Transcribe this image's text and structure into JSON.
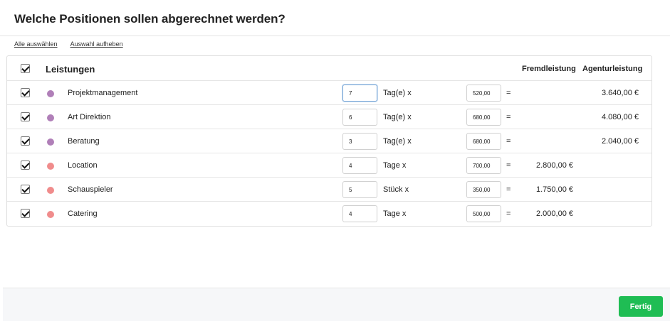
{
  "dialog": {
    "title": "Welche Positionen sollen abgerechnet werden?"
  },
  "links": {
    "select_all": "Alle auswählen",
    "deselect": "Auswahl aufheben"
  },
  "table": {
    "header": {
      "label": "Leistungen",
      "col_fremd": "Fremdleistung",
      "col_agentur": "Agenturleistung"
    },
    "rows": [
      {
        "name": "Projektmanagement",
        "qty": "7",
        "unit": "Tag(e) x",
        "price": "520,00",
        "eq": "=",
        "fremd": "",
        "agentur": "3.640,00 €",
        "color": "#b07fb8"
      },
      {
        "name": "Art Direktion",
        "qty": "6",
        "unit": "Tag(e) x",
        "price": "680,00",
        "eq": "=",
        "fremd": "",
        "agentur": "4.080,00 €",
        "color": "#b07fb8"
      },
      {
        "name": "Beratung",
        "qty": "3",
        "unit": "Tag(e) x",
        "price": "680,00",
        "eq": "=",
        "fremd": "",
        "agentur": "2.040,00 €",
        "color": "#b07fb8"
      },
      {
        "name": "Location",
        "qty": "4",
        "unit": "Tage x",
        "price": "700,00",
        "eq": "=",
        "fremd": "2.800,00 €",
        "agentur": "",
        "color": "#f08c8c"
      },
      {
        "name": "Schauspieler",
        "qty": "5",
        "unit": "Stück x",
        "price": "350,00",
        "eq": "=",
        "fremd": "1.750,00 €",
        "agentur": "",
        "color": "#f08c8c"
      },
      {
        "name": "Catering",
        "qty": "4",
        "unit": "Tage x",
        "price": "500,00",
        "eq": "=",
        "fremd": "2.000,00 €",
        "agentur": "",
        "color": "#f08c8c"
      }
    ]
  },
  "footer": {
    "done_label": "Fertig",
    "done_color": "#1fbd54"
  }
}
